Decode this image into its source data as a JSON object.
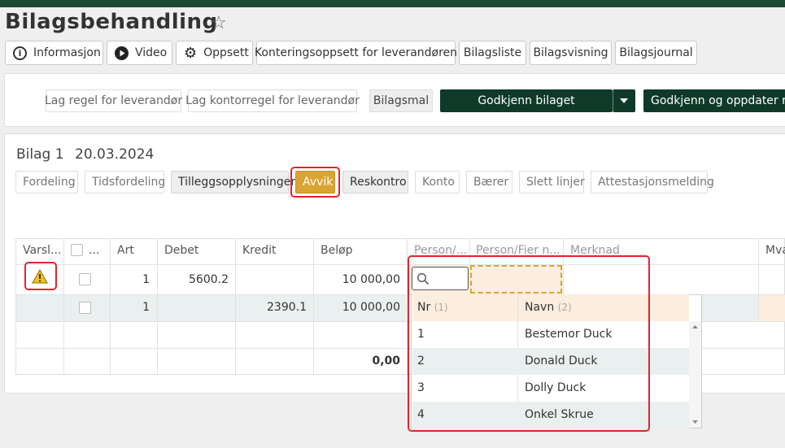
{
  "title": "Bilagsbehandling",
  "toolbar": {
    "informasjon": "Informasjon",
    "video": "Video",
    "oppsett": "Oppsett",
    "konteringsoppsett": "Konteringsoppsett for leverandøren",
    "bilagsliste": "Bilagsliste",
    "bilagsvisning": "Bilagsvisning",
    "bilagsjournal": "Bilagsjournal"
  },
  "actions": {
    "lag_regel": "Lag regel for leverandør",
    "lag_kontorregel": "Lag kontorregel for leverandør",
    "bilagsmal": "Bilagsmal",
    "godkjenn": "Godkjenn bilaget",
    "godkjenn_oppdater": "Godkjenn og oppdater regel"
  },
  "bilag": {
    "label": "Bilag 1",
    "date": "20.03.2024"
  },
  "subtabs": {
    "fordeling": "Fordeling",
    "tidsfordeling": "Tidsfordeling",
    "tilleggsopplysninger": "Tilleggsopplysninger",
    "avvik": "Avvik",
    "reskontro": "Reskontro",
    "konto": "Konto",
    "baerer": "Bærer",
    "slett_linjer": "Slett linjer",
    "attestasjonsmelding": "Attestasjonsmelding"
  },
  "table": {
    "headers": {
      "varsel": "Varsl...",
      "check": "...",
      "art": "Art",
      "debet": "Debet",
      "kredit": "Kredit",
      "belop": "Beløp",
      "person": "Person/...",
      "person_fier": "Person/Fier n...",
      "merknad": "Merknad",
      "mva": "Mva"
    },
    "rows": [
      {
        "art": "1",
        "debet": "5600.2",
        "kredit": "",
        "belop": "10 000,00"
      },
      {
        "art": "1",
        "debet": "",
        "kredit": "2390.1",
        "belop": "10 000,00"
      }
    ],
    "total": "0,00"
  },
  "dropdown": {
    "col_nr": "Nr",
    "col_nr_idx": "(1)",
    "col_navn": "Navn",
    "col_navn_idx": "(2)",
    "items": [
      {
        "nr": "1",
        "navn": "Bestemor Duck"
      },
      {
        "nr": "2",
        "navn": "Donald Duck"
      },
      {
        "nr": "3",
        "navn": "Dolly Duck"
      },
      {
        "nr": "4",
        "navn": "Onkel Skrue"
      }
    ]
  },
  "colors": {
    "brand": "#1c4a34",
    "primary_button": "#0f3a29",
    "active_tab": "#d9a431",
    "highlight": "#e3232c",
    "edit_cell": "#fbeede"
  }
}
